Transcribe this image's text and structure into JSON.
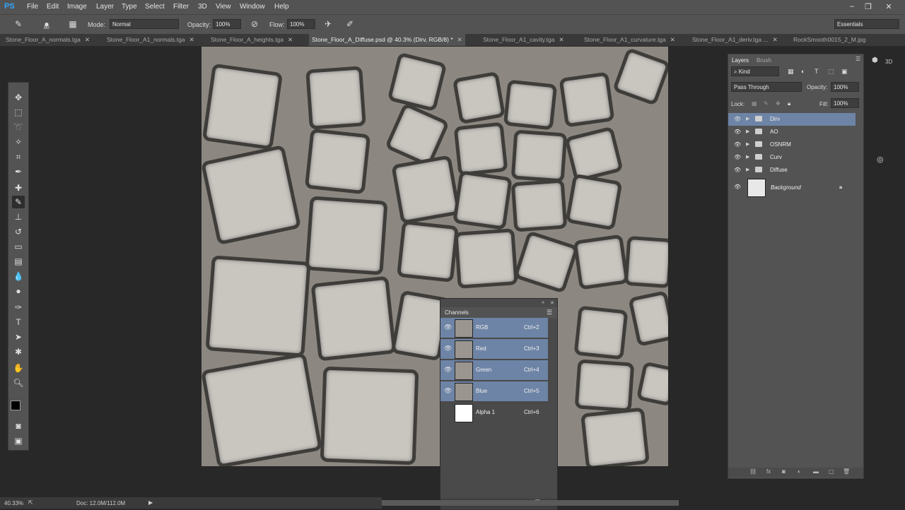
{
  "app": {
    "logo": "PS"
  },
  "menu": [
    "File",
    "Edit",
    "Image",
    "Layer",
    "Type",
    "Select",
    "Filter",
    "3D",
    "View",
    "Window",
    "Help"
  ],
  "window_controls": {
    "minimize": "–",
    "restore": "❐",
    "close": "✕"
  },
  "options_bar": {
    "brush_size": "80",
    "mode_label": "Mode:",
    "mode_value": "Normal",
    "opacity_label": "Opacity:",
    "opacity_value": "100%",
    "flow_label": "Flow:",
    "flow_value": "100%",
    "workspace": "Essentials"
  },
  "tabs": [
    {
      "label": "Stone_Floor_A_normals.tga",
      "active": false
    },
    {
      "label": "Stone_Floor_A1_normals.tga",
      "active": false
    },
    {
      "label": "Stone_Floor_A_heights.tga",
      "active": false
    },
    {
      "label": "Stone_Floor_A_Diffuse.psd @ 40.3% (Dirv, RGB/8) *",
      "active": true
    },
    {
      "label": "Stone_Floor_A1_cavity.tga",
      "active": false
    },
    {
      "label": "Stone_Floor_A1_curvature.tga",
      "active": false
    },
    {
      "label": "Stone_Floor_A1_deriv.tga ...",
      "active": false
    },
    {
      "label": "RockSmooth0015_2_M.jpg",
      "active": false
    }
  ],
  "channels_panel": {
    "title": "Channels",
    "rows": [
      {
        "name": "RGB",
        "shortcut": "Ctrl+2",
        "highlighted": true
      },
      {
        "name": "Red",
        "shortcut": "Ctrl+3",
        "highlighted": true
      },
      {
        "name": "Green",
        "shortcut": "Ctrl+4",
        "highlighted": true
      },
      {
        "name": "Blue",
        "shortcut": "Ctrl+5",
        "highlighted": true
      },
      {
        "name": "Alpha 1",
        "shortcut": "Ctrl+6",
        "highlighted": false
      }
    ]
  },
  "layers_panel": {
    "tabs": [
      "Layers",
      "Brush"
    ],
    "filter": "Kind",
    "blend_mode": "Pass Through",
    "opacity_label": "Opacity:",
    "opacity_value": "100%",
    "lock_label": "Lock:",
    "fill_label": "Fill:",
    "fill_value": "100%",
    "layers": [
      {
        "name": "Dirv",
        "type": "group",
        "selected": true
      },
      {
        "name": "AO",
        "type": "group",
        "selected": false
      },
      {
        "name": "OSNRM",
        "type": "group",
        "selected": false
      },
      {
        "name": "Curv",
        "type": "group",
        "selected": false
      },
      {
        "name": "Diffuse",
        "type": "group",
        "selected": false
      },
      {
        "name": "Background",
        "type": "image",
        "selected": false
      }
    ],
    "side_label": "3D"
  },
  "status_bar": {
    "zoom": "40.33%",
    "doc": "Doc: 12.0M/112.0M"
  },
  "colors": {
    "selection": "#6d84a6",
    "panel": "#535353",
    "background": "#282828"
  }
}
